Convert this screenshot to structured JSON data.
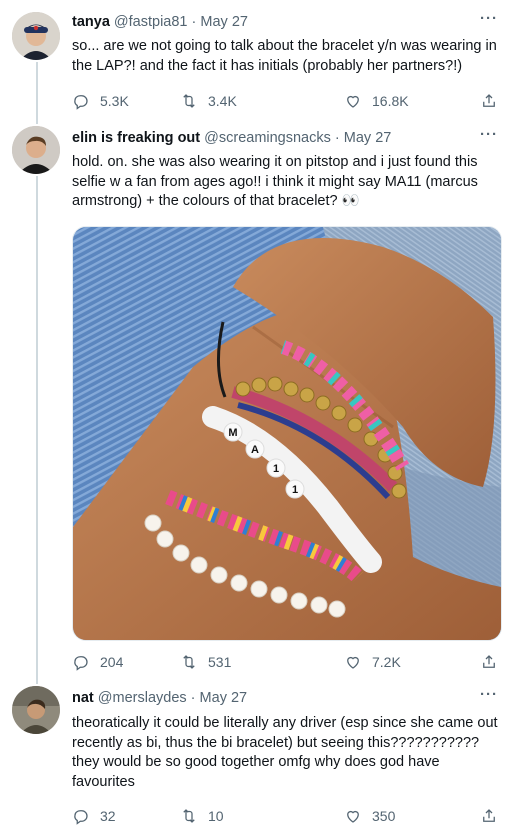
{
  "tweets": [
    {
      "name": "tanya",
      "handle": "@fastpia81",
      "date": "May 27",
      "text": "so... are we not going to talk about the bracelet y/n was wearing in the LAP?! and the fact it has initials (probably her partners?!)",
      "replies": "5.3K",
      "retweets": "3.4K",
      "likes": "16.8K"
    },
    {
      "name": "elin is freaking out",
      "handle": "@screamingsnacks",
      "date": "May 27",
      "text": "hold. on. she was also wearing it on pitstop and i just found this selfie w a fan from ages ago!! i think it might say MA11 (marcus armstrong) + the colours of that bracelet? 👀",
      "replies": "204",
      "retweets": "531",
      "likes": "7.2K"
    },
    {
      "name": "nat",
      "handle": "@merslaydes",
      "date": "May 27",
      "text": "theoratically it could be literally any driver (esp since she came out recently as bi, thus the bi bracelet) but seeing this??????????? they would be so good together omfg why does god have favourites",
      "replies": "32",
      "retweets": "10",
      "likes": "350"
    }
  ],
  "photo": {
    "bead_letters": [
      "M",
      "A",
      "1",
      "1"
    ],
    "colors": {
      "sweater": "#5b86bf",
      "jeans": "#9ab0c9",
      "skin": "#b8764a"
    }
  },
  "icons": [
    "more-icon",
    "reply-icon",
    "retweet-icon",
    "like-icon",
    "share-icon"
  ],
  "colors": {
    "text": "#0f1419",
    "meta": "#536471",
    "divider": "#cfd9de"
  }
}
